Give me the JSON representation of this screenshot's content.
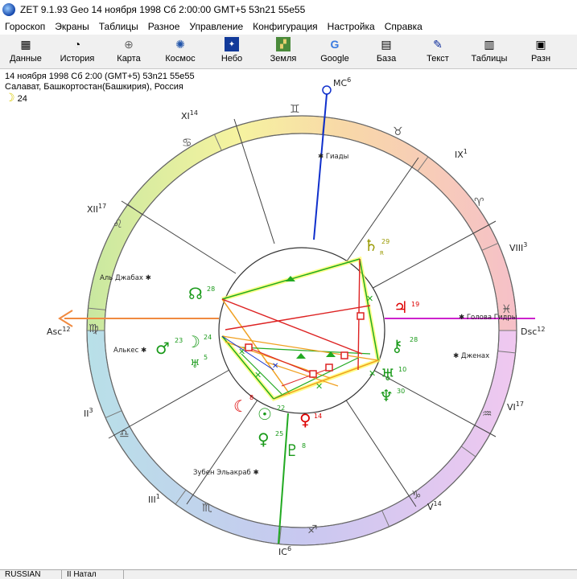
{
  "window": {
    "title": "ZET 9.1.93 Geo   14 ноября 1998  Сб   2:00:00 GMT+5 53n21  55e55"
  },
  "menu": [
    "Гороскоп",
    "Экраны",
    "Таблицы",
    "Разное",
    "Управление",
    "Конфигурация",
    "Настройка",
    "Справка"
  ],
  "toolbar": [
    {
      "label": "Данные",
      "icon": "data-grid-icon"
    },
    {
      "label": "История",
      "icon": "history-icon"
    },
    {
      "label": "Карта",
      "icon": "map-icon"
    },
    {
      "label": "Космос",
      "icon": "cosmos-icon"
    },
    {
      "label": "Небо",
      "icon": "sky-icon"
    },
    {
      "label": "Земля",
      "icon": "earth-icon"
    },
    {
      "label": "Google",
      "icon": "google-icon"
    },
    {
      "label": "База",
      "icon": "database-icon"
    },
    {
      "label": "Текст",
      "icon": "text-icon"
    },
    {
      "label": "Таблицы",
      "icon": "tables-icon"
    },
    {
      "label": "Разн",
      "icon": "misc-icon"
    }
  ],
  "info": {
    "line1": "14 ноября 1998  Сб   2:00  (GMT+5)  53n21   55e55",
    "line2": "Салават, Башкортостан(Башкирия), Россия",
    "moon_day": "24"
  },
  "chart": {
    "asc_label": "Asc",
    "asc_deg": "12",
    "dsc_label": "Dsc",
    "dsc_deg": "12",
    "mc_label": "MC",
    "mc_deg": "6",
    "ic_label": "IC",
    "ic_deg": "6",
    "houses": [
      {
        "label": "XI",
        "deg": "14"
      },
      {
        "label": "XII",
        "deg": "17"
      },
      {
        "label": "II",
        "deg": "3"
      },
      {
        "label": "III",
        "deg": "1"
      },
      {
        "label": "V",
        "deg": "14"
      },
      {
        "label": "VI",
        "deg": "17"
      },
      {
        "label": "VIII",
        "deg": "3"
      },
      {
        "label": "IX",
        "deg": "1"
      }
    ],
    "stars": [
      "Гиады",
      "Аль Джабах",
      "Алькес",
      "Зубен Эльакраб",
      "Голова Гидры",
      "Дженах"
    ],
    "planets": [
      {
        "glyph": "♄",
        "deg": "29",
        "sub": "R",
        "color": "#999900"
      },
      {
        "glyph": "♃",
        "deg": "19",
        "color": "#dd0000"
      },
      {
        "glyph": "☊",
        "deg": "28",
        "color": "#1a9a1a"
      },
      {
        "glyph": "♂",
        "deg": "23",
        "color": "#1a9a1a"
      },
      {
        "glyph": "☽",
        "deg": "24",
        "color": "#1a9a1a"
      },
      {
        "glyph": "♅",
        "deg": "5",
        "color": "#1a9a1a"
      },
      {
        "glyph": "⚷",
        "deg": "28",
        "color": "#1a9a1a"
      },
      {
        "glyph": "♅",
        "deg": "10",
        "color": "#1a9a1a"
      },
      {
        "glyph": "♆",
        "deg": "30",
        "color": "#1a9a1a"
      },
      {
        "glyph": "☾",
        "deg": "8",
        "color": "#dd0000"
      },
      {
        "glyph": "☉",
        "deg": "22",
        "color": "#1a9a1a"
      },
      {
        "glyph": "♀",
        "deg": "14",
        "color": "#dd0000"
      },
      {
        "glyph": "♀",
        "deg": "25",
        "color": "#1a9a1a"
      },
      {
        "glyph": "♇",
        "deg": "8",
        "color": "#1a9a1a"
      }
    ]
  },
  "status": {
    "lang": "RUSSIAN",
    "mode": "II Натал"
  }
}
